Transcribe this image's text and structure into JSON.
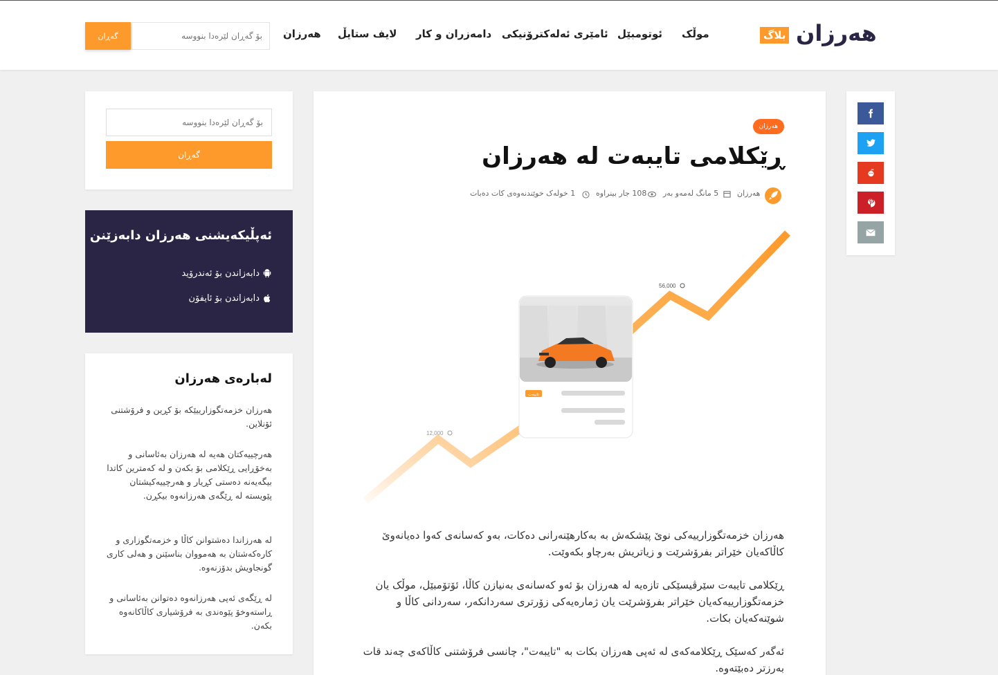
{
  "header": {
    "logo_text": "هەرزان",
    "logo_badge": "بلاگ",
    "nav": [
      "موڵک",
      "ئوتومبێل",
      "ئامێری ئەلەکترۆنیکی",
      "دامەزران و کار",
      "لایف ستایڵ",
      "هەرزان"
    ],
    "search_placeholder": "بۆ گەڕان لێرەدا بنووسە",
    "search_button": "گەڕان"
  },
  "share": {
    "buttons": [
      {
        "name": "facebook",
        "color": "#3b5998"
      },
      {
        "name": "twitter",
        "color": "#1da1f2"
      },
      {
        "name": "reddit",
        "color": "#e53a1f"
      },
      {
        "name": "pinterest",
        "color": "#cb2027"
      },
      {
        "name": "email",
        "color": "#95a5a6"
      }
    ]
  },
  "post": {
    "category": "هەرزان",
    "title": "ڕێکلامی تایبەت لە هەرزان",
    "author": "هەرزان",
    "date": "5 مانگ لەمەو بەر",
    "views": "108 جار بینراوە",
    "read_time": "1 خولەک خوێندنەوەی کات دەبات",
    "chart_label_high": "56,000",
    "chart_label_low": "12,000",
    "card_badge": "تایبەت",
    "paragraphs": [
      "هەرزان خزمەتگوزارییەکی نوێ پێشکەش بە بەکارهێنەرانی دەکات، بەو کەسانەی کەوا دەیانەوێ کاڵاکەیان خێراتر بفرۆشرێت و زیاتریش بەرچاو بکەوێت.",
      "ڕێکلامی تایبەت سێرڤیسێکی تازەیە لە هەرزان بۆ ئەو کەسانەی بەنیازن کاڵا، ئۆتۆمبێل، موڵک یان خزمەتگوزارییەکەیان خێراتر بفرۆشرێت یان ژمارەیەکی زۆرتری سەردانکەر، سەردانی کاڵا و شوێنەکەیان بکات.",
      "ئەگەر کەسێک ڕێکلامەکەی لە ئەپی هەرزان بکات بە \"تایبەت\"، چانسی فرۆشتنی کاڵاکەی چەند قات بەرزتر دەبێتەوە."
    ]
  },
  "sidebar": {
    "search_placeholder": "بۆ گەڕان لێرەدا بنووسە",
    "search_button": "گەڕان",
    "app": {
      "title": "ئەپڵیکەیشنی هەرزان دابەزێنن",
      "android": "دابەزاندن بۆ ئەندرۆید",
      "ios": "دابەزاندن بۆ ئایفۆن"
    },
    "about": {
      "title": "لەبارەی هەرزان",
      "paragraphs": [
        "هەرزان خزمەتگوزارییێکە بۆ کڕین و فرۆشتنی ئۆنلاین.",
        "هەرچییەکتان هەیە لە هەرزان بەئاسانی و بەخۆڕایی ڕێکلامی بۆ بکەن و لە کەمترین کاتدا بیگەیەنە دەستی کڕیار و هەرچییەکیشتان پێویستە لە ڕێگەی هەرزانەوە بیکڕن.",
        "لە هەرزاندا دەشتوانن کاڵا و خزمەتگوزاری و کارەکەشتان بە هەمووان بناسێنن و هەلی کاری گونجاویش بدۆزنەوە.",
        "لە ڕێگەی ئەپی هەرزانەوە دەتوانن بەئاسانی و ڕاستەوخۆ پێوەندی بە فرۆشیاری کاڵاکانەوە بکەن."
      ]
    }
  }
}
